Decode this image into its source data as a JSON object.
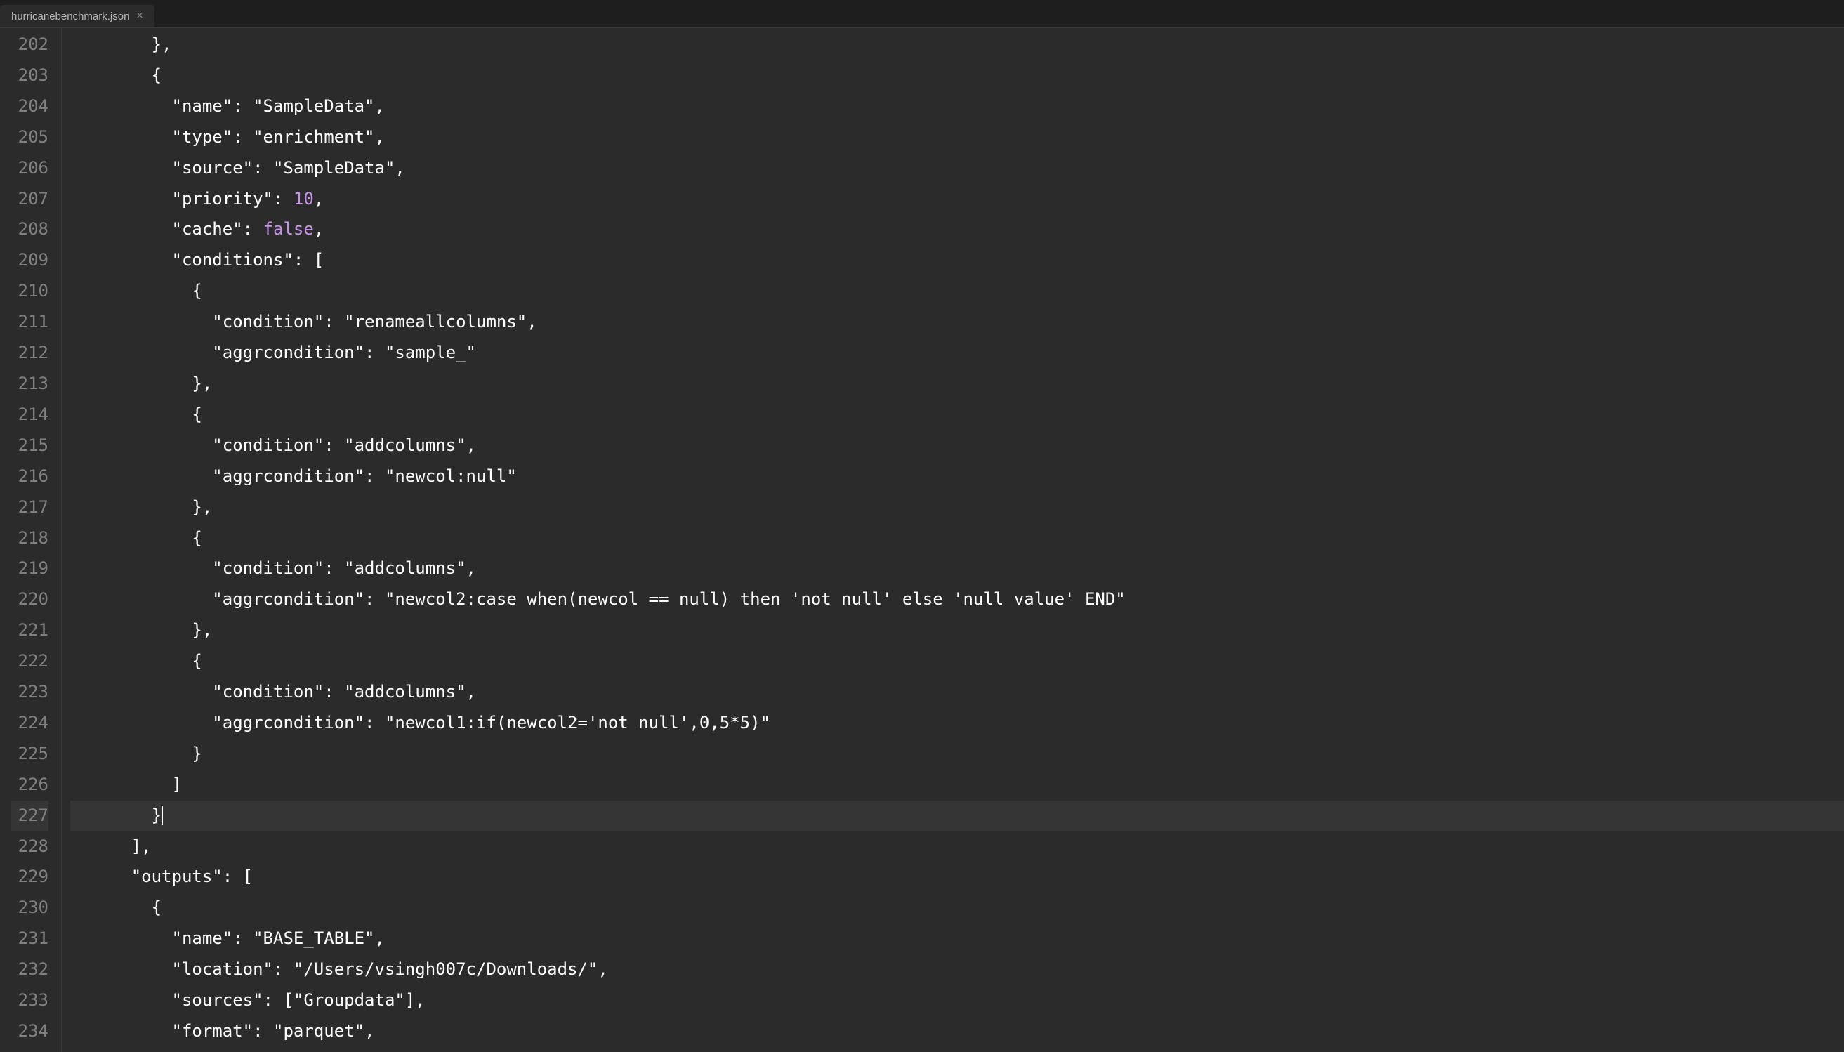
{
  "tab": {
    "filename": "hurricanebenchmark.json",
    "close_symbol": "×"
  },
  "line_numbers": [
    "202",
    "203",
    "204",
    "205",
    "206",
    "207",
    "208",
    "209",
    "210",
    "211",
    "212",
    "213",
    "214",
    "215",
    "216",
    "217",
    "218",
    "219",
    "220",
    "221",
    "222",
    "223",
    "224",
    "225",
    "226",
    "227",
    "228",
    "229",
    "230",
    "231",
    "232",
    "233",
    "234"
  ],
  "active_line_index": 25,
  "code_segments": [
    [
      {
        "t": "        },",
        "c": "punct"
      }
    ],
    [
      {
        "t": "        {",
        "c": "punct"
      }
    ],
    [
      {
        "t": "          ",
        "c": "punct"
      },
      {
        "t": "\"name\"",
        "c": "key"
      },
      {
        "t": ": ",
        "c": "punct"
      },
      {
        "t": "\"SampleData\"",
        "c": "string"
      },
      {
        "t": ",",
        "c": "punct"
      }
    ],
    [
      {
        "t": "          ",
        "c": "punct"
      },
      {
        "t": "\"type\"",
        "c": "key"
      },
      {
        "t": ": ",
        "c": "punct"
      },
      {
        "t": "\"enrichment\"",
        "c": "string"
      },
      {
        "t": ",",
        "c": "punct"
      }
    ],
    [
      {
        "t": "          ",
        "c": "punct"
      },
      {
        "t": "\"source\"",
        "c": "key"
      },
      {
        "t": ": ",
        "c": "punct"
      },
      {
        "t": "\"SampleData\"",
        "c": "string"
      },
      {
        "t": ",",
        "c": "punct"
      }
    ],
    [
      {
        "t": "          ",
        "c": "punct"
      },
      {
        "t": "\"priority\"",
        "c": "key"
      },
      {
        "t": ": ",
        "c": "punct"
      },
      {
        "t": "10",
        "c": "number"
      },
      {
        "t": ",",
        "c": "punct"
      }
    ],
    [
      {
        "t": "          ",
        "c": "punct"
      },
      {
        "t": "\"cache\"",
        "c": "key"
      },
      {
        "t": ": ",
        "c": "punct"
      },
      {
        "t": "false",
        "c": "boolean"
      },
      {
        "t": ",",
        "c": "punct"
      }
    ],
    [
      {
        "t": "          ",
        "c": "punct"
      },
      {
        "t": "\"conditions\"",
        "c": "key"
      },
      {
        "t": ": [",
        "c": "punct"
      }
    ],
    [
      {
        "t": "            {",
        "c": "punct"
      }
    ],
    [
      {
        "t": "              ",
        "c": "punct"
      },
      {
        "t": "\"condition\"",
        "c": "key"
      },
      {
        "t": ": ",
        "c": "punct"
      },
      {
        "t": "\"renameallcolumns\"",
        "c": "string"
      },
      {
        "t": ",",
        "c": "punct"
      }
    ],
    [
      {
        "t": "              ",
        "c": "punct"
      },
      {
        "t": "\"aggrcondition\"",
        "c": "key"
      },
      {
        "t": ": ",
        "c": "punct"
      },
      {
        "t": "\"sample_\"",
        "c": "string"
      }
    ],
    [
      {
        "t": "            },",
        "c": "punct"
      }
    ],
    [
      {
        "t": "            {",
        "c": "punct"
      }
    ],
    [
      {
        "t": "              ",
        "c": "punct"
      },
      {
        "t": "\"condition\"",
        "c": "key"
      },
      {
        "t": ": ",
        "c": "punct"
      },
      {
        "t": "\"addcolumns\"",
        "c": "string"
      },
      {
        "t": ",",
        "c": "punct"
      }
    ],
    [
      {
        "t": "              ",
        "c": "punct"
      },
      {
        "t": "\"aggrcondition\"",
        "c": "key"
      },
      {
        "t": ": ",
        "c": "punct"
      },
      {
        "t": "\"newcol:null\"",
        "c": "string"
      }
    ],
    [
      {
        "t": "            },",
        "c": "punct"
      }
    ],
    [
      {
        "t": "            {",
        "c": "punct"
      }
    ],
    [
      {
        "t": "              ",
        "c": "punct"
      },
      {
        "t": "\"condition\"",
        "c": "key"
      },
      {
        "t": ": ",
        "c": "punct"
      },
      {
        "t": "\"addcolumns\"",
        "c": "string"
      },
      {
        "t": ",",
        "c": "punct"
      }
    ],
    [
      {
        "t": "              ",
        "c": "punct"
      },
      {
        "t": "\"aggrcondition\"",
        "c": "key"
      },
      {
        "t": ": ",
        "c": "punct"
      },
      {
        "t": "\"newcol2:case when(newcol == null) then 'not null' else 'null value' END\"",
        "c": "string"
      }
    ],
    [
      {
        "t": "            },",
        "c": "punct"
      }
    ],
    [
      {
        "t": "            {",
        "c": "punct"
      }
    ],
    [
      {
        "t": "              ",
        "c": "punct"
      },
      {
        "t": "\"condition\"",
        "c": "key"
      },
      {
        "t": ": ",
        "c": "punct"
      },
      {
        "t": "\"addcolumns\"",
        "c": "string"
      },
      {
        "t": ",",
        "c": "punct"
      }
    ],
    [
      {
        "t": "              ",
        "c": "punct"
      },
      {
        "t": "\"aggrcondition\"",
        "c": "key"
      },
      {
        "t": ": ",
        "c": "punct"
      },
      {
        "t": "\"newcol1:if(newcol2='not null',0,5*5)\"",
        "c": "string"
      }
    ],
    [
      {
        "t": "            }",
        "c": "punct"
      }
    ],
    [
      {
        "t": "          ]",
        "c": "punct"
      }
    ],
    [
      {
        "t": "        }",
        "c": "punct"
      },
      {
        "t": "",
        "c": "cursor"
      }
    ],
    [
      {
        "t": "      ],",
        "c": "punct"
      }
    ],
    [
      {
        "t": "      ",
        "c": "punct"
      },
      {
        "t": "\"outputs\"",
        "c": "key"
      },
      {
        "t": ": [",
        "c": "punct"
      }
    ],
    [
      {
        "t": "        {",
        "c": "punct"
      }
    ],
    [
      {
        "t": "          ",
        "c": "punct"
      },
      {
        "t": "\"name\"",
        "c": "key"
      },
      {
        "t": ": ",
        "c": "punct"
      },
      {
        "t": "\"BASE_TABLE\"",
        "c": "string"
      },
      {
        "t": ",",
        "c": "punct"
      }
    ],
    [
      {
        "t": "          ",
        "c": "punct"
      },
      {
        "t": "\"location\"",
        "c": "key"
      },
      {
        "t": ": ",
        "c": "punct"
      },
      {
        "t": "\"/Users/vsingh007c/Downloads/\"",
        "c": "string"
      },
      {
        "t": ",",
        "c": "punct"
      }
    ],
    [
      {
        "t": "          ",
        "c": "punct"
      },
      {
        "t": "\"sources\"",
        "c": "key"
      },
      {
        "t": ": [",
        "c": "punct"
      },
      {
        "t": "\"Groupdata\"",
        "c": "string"
      },
      {
        "t": "],",
        "c": "punct"
      }
    ],
    [
      {
        "t": "          ",
        "c": "punct"
      },
      {
        "t": "\"format\"",
        "c": "key"
      },
      {
        "t": ": ",
        "c": "punct"
      },
      {
        "t": "\"parquet\"",
        "c": "string"
      },
      {
        "t": ",",
        "c": "punct"
      }
    ]
  ]
}
